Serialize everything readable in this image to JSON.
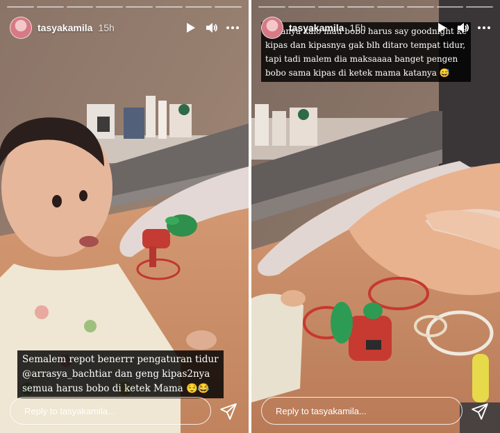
{
  "stories": [
    {
      "username": "tasyakamila",
      "time": "15h",
      "caption_lines": [
        "Semalem repot benerrr pengaturan tidur",
        "@arrasya_bachtiar dan geng kipas2nya",
        "semua harus bobo di ketek Mama 😌😂"
      ],
      "reply_placeholder": "Reply to tasyakamila..."
    },
    {
      "username": "tasyakamila",
      "time": "15h",
      "caption_lines": [
        "Kasanya kalo mau bobo harus say goodnight ke",
        "kipas dan kipasnya gak blh ditaro tempat tidur,",
        "tapi tadi malem dia maksaaaa banget pengen",
        "bobo sama kipas di ketek mama katanya 😅"
      ],
      "reply_placeholder": "Reply to tasyakamila..."
    }
  ],
  "icons": [
    "play-icon",
    "volume-icon",
    "more-options-icon",
    "send-icon"
  ]
}
